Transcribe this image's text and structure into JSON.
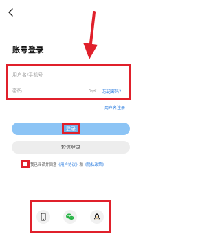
{
  "header": {
    "back_icon": "chevron-left-icon"
  },
  "page_title": "账号登录",
  "form": {
    "username_placeholder": "用户名/手机号",
    "password_placeholder": "密码",
    "forgot_password": "忘记密码?",
    "register": "用户名注册"
  },
  "buttons": {
    "login": "登录",
    "sms_login": "短信登录"
  },
  "agreement": {
    "prefix": "我已阅读并同意",
    "user_agreement": "《用户协议》",
    "and": "和",
    "privacy_policy": "《隐私政策》"
  },
  "alternative_login": {
    "icons": [
      "phone-icon",
      "wechat-icon",
      "qq-icon"
    ]
  },
  "colors": {
    "annotation_red": "#e0202b",
    "primary_blue": "#8cc4f5",
    "link_blue": "#2f7fe0"
  }
}
